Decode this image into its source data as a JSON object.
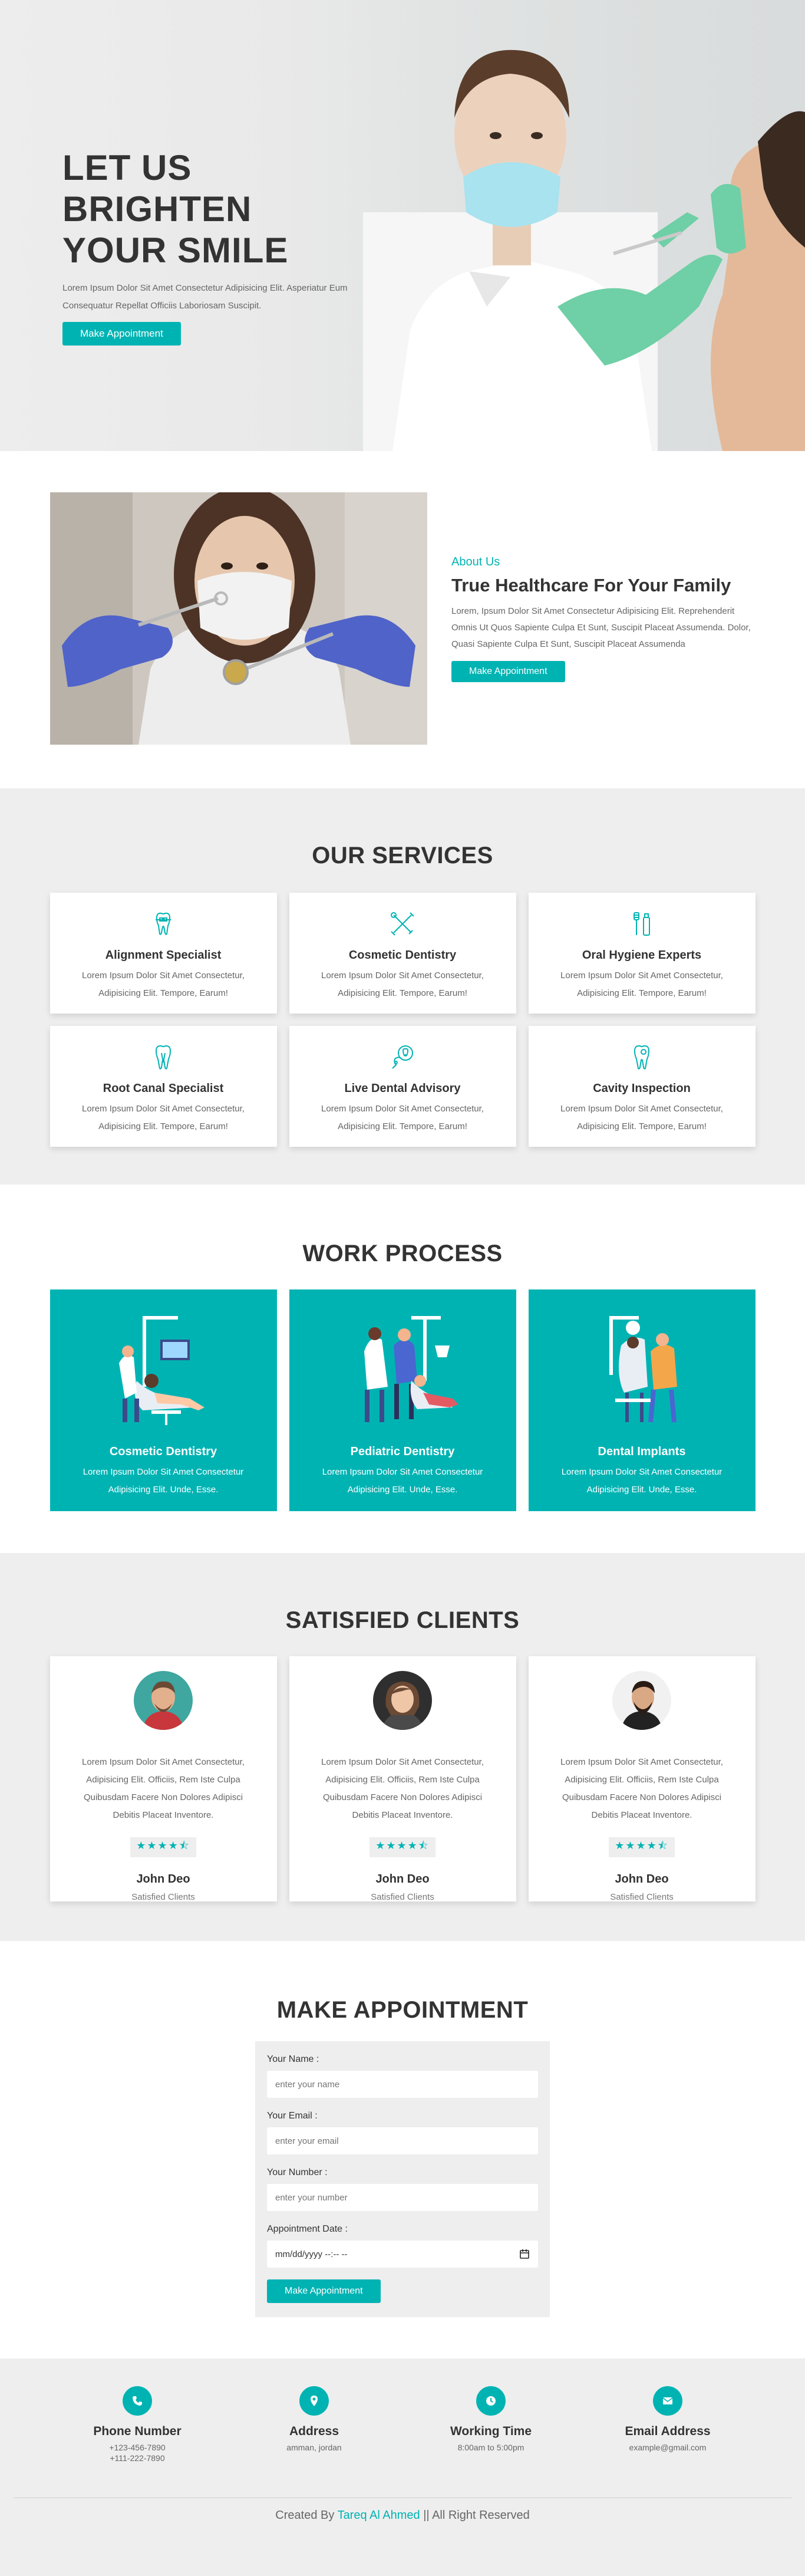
{
  "hero": {
    "title_line1": "LET US BRIGHTEN",
    "title_line2": "YOUR SMILE",
    "description": "Lorem Ipsum Dolor Sit Amet Consectetur Adipisicing Elit. Asperiatur Eum Consequatur Repellat Officiis Laboriosam Suscipit.",
    "button": "Make Appointment"
  },
  "about": {
    "eyebrow": "About Us",
    "title": "True Healthcare For Your Family",
    "description": "Lorem, Ipsum Dolor Sit Amet Consectetur Adipisicing Elit. Reprehenderit Omnis Ut Quos Sapiente Culpa Et Sunt, Suscipit Placeat Assumenda. Dolor, Quasi Sapiente Culpa Et Sunt, Suscipit Placeat Assumenda",
    "button": "Make Appointment"
  },
  "services": {
    "title": "OUR SERVICES",
    "items": [
      {
        "icon": "tooth-brace-icon",
        "title": "Alignment Specialist",
        "text": "Lorem Ipsum Dolor Sit Amet Consectetur, Adipisicing Elit. Tempore, Earum!"
      },
      {
        "icon": "dental-tools-icon",
        "title": "Cosmetic Dentistry",
        "text": "Lorem Ipsum Dolor Sit Amet Consectetur, Adipisicing Elit. Tempore, Earum!"
      },
      {
        "icon": "toothbrush-paste-icon",
        "title": "Oral Hygiene Experts",
        "text": "Lorem Ipsum Dolor Sit Amet Consectetur, Adipisicing Elit. Tempore, Earum!"
      },
      {
        "icon": "tooth-root-icon",
        "title": "Root Canal Specialist",
        "text": "Lorem Ipsum Dolor Sit Amet Consectetur, Adipisicing Elit. Tempore, Earum!"
      },
      {
        "icon": "dental-chat-icon",
        "title": "Live Dental Advisory",
        "text": "Lorem Ipsum Dolor Sit Amet Consectetur, Adipisicing Elit. Tempore, Earum!"
      },
      {
        "icon": "tooth-cavity-icon",
        "title": "Cavity Inspection",
        "text": "Lorem Ipsum Dolor Sit Amet Consectetur, Adipisicing Elit. Tempore, Earum!"
      }
    ]
  },
  "process": {
    "title": "WORK PROCESS",
    "items": [
      {
        "title": "Cosmetic Dentistry",
        "text": "Lorem Ipsum Dolor Sit Amet Consectetur Adipisicing Elit. Unde, Esse."
      },
      {
        "title": "Pediatric Dentistry",
        "text": "Lorem Ipsum Dolor Sit Amet Consectetur Adipisicing Elit. Unde, Esse."
      },
      {
        "title": "Dental Implants",
        "text": "Lorem Ipsum Dolor Sit Amet Consectetur Adipisicing Elit. Unde, Esse."
      }
    ]
  },
  "clients": {
    "title": "SATISFIED CLIENTS",
    "items": [
      {
        "quote": "Lorem Ipsum Dolor Sit Amet Consectetur, Adipisicing Elit. Officiis, Rem Iste Culpa Quibusdam Facere Non Dolores Adipisci Debitis Placeat Inventore.",
        "stars": "★★★★⯪",
        "rating": 4.5,
        "name": "John Deo",
        "role": "Satisfied Clients"
      },
      {
        "quote": "Lorem Ipsum Dolor Sit Amet Consectetur, Adipisicing Elit. Officiis, Rem Iste Culpa Quibusdam Facere Non Dolores Adipisci Debitis Placeat Inventore.",
        "stars": "★★★★⯪",
        "rating": 4.5,
        "name": "John Deo",
        "role": "Satisfied Clients"
      },
      {
        "quote": "Lorem Ipsum Dolor Sit Amet Consectetur, Adipisicing Elit. Officiis, Rem Iste Culpa Quibusdam Facere Non Dolores Adipisci Debitis Placeat Inventore.",
        "stars": "★★★★⯪",
        "rating": 4.5,
        "name": "John Deo",
        "role": "Satisfied Clients"
      }
    ]
  },
  "appointment": {
    "title": "MAKE APPOINTMENT",
    "name_label": "Your Name :",
    "name_placeholder": "enter your name",
    "email_label": "Your Email :",
    "email_placeholder": "enter your email",
    "number_label": "Your Number :",
    "number_placeholder": "enter your number",
    "date_label": "Appointment Date :",
    "date_value": "mm/dd/yyyy --:-- --",
    "button": "Make Appointment"
  },
  "footer": {
    "items": [
      {
        "icon": "phone-icon",
        "title": "Phone Number",
        "lines": [
          "+123-456-7890",
          "+111-222-7890"
        ]
      },
      {
        "icon": "location-pin-icon",
        "title": "Address",
        "lines": [
          "amman, jordan"
        ]
      },
      {
        "icon": "clock-icon",
        "title": "Working Time",
        "lines": [
          "8:00am to 5:00pm"
        ]
      },
      {
        "icon": "envelope-icon",
        "title": "Email Address",
        "lines": [
          "example@gmail.com"
        ]
      }
    ],
    "credit_prefix": "Created By",
    "credit_author": "Tareq Al Ahmed",
    "credit_suffix": "|| All Right Reserved"
  },
  "colors": {
    "accent": "#00b3b3",
    "section_bg": "#eeeeee",
    "text": "#333333"
  }
}
